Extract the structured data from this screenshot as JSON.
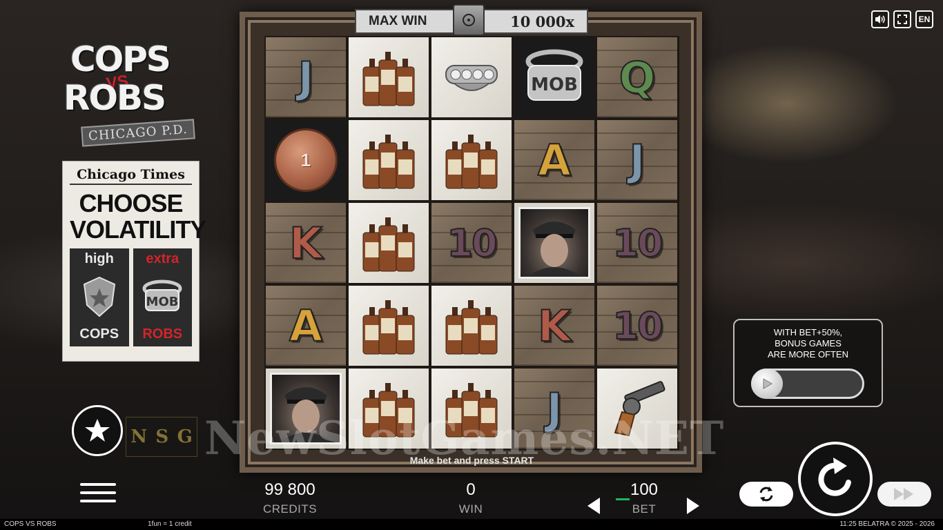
{
  "system": {
    "lang": "EN"
  },
  "logo": {
    "line1": "COPS",
    "vs": "VS",
    "line2": "ROBS",
    "sub": "CHICAGO P.D."
  },
  "volatility": {
    "paper_title": "Chicago Times",
    "headline_1": "CHOOSE",
    "headline_2": "VOLATILITY",
    "options": [
      {
        "top": "high",
        "bottom": "COPS",
        "icon": "police-badge-icon"
      },
      {
        "top": "extra",
        "bottom": "ROBS",
        "icon": "mob-ring-icon"
      }
    ]
  },
  "maxwin": {
    "label": "MAX WIN",
    "value": "10 000x"
  },
  "grid": {
    "rows": [
      [
        "J",
        "whiskey",
        "knuckles",
        "mob-ring",
        "Q"
      ],
      [
        "coin",
        "whiskey",
        "whiskey",
        "A",
        "J"
      ],
      [
        "K",
        "whiskey",
        "10",
        "cop",
        "10"
      ],
      [
        "A",
        "whiskey",
        "whiskey",
        "K",
        "10"
      ],
      [
        "cop",
        "whiskey",
        "whiskey",
        "J",
        "revolver"
      ]
    ],
    "coin_value": "1",
    "bottle_label": "SCOTCH WHISKY"
  },
  "letter_colors": {
    "J": "#7d95ab",
    "Q": "#5e8a50",
    "A": "#d6a23a",
    "K": "#b05a4a",
    "10": "#6a4a5a"
  },
  "make_bet": "Make bet and press START",
  "bonus": {
    "line1": "WITH BET+50%,",
    "line2": "BONUS GAMES",
    "line3": "ARE MORE OFTEN"
  },
  "watermark": "NewSlotGames.NET",
  "provider": {
    "letters": [
      "N",
      "S",
      "G"
    ]
  },
  "stats": {
    "credits_value": "99 800",
    "credits_label": "CREDITS",
    "win_value": "0",
    "win_label": "WIN",
    "bet_value": "100",
    "bet_label": "BET"
  },
  "footer": {
    "title": "COPS VS ROBS",
    "rate": "1fun = 1 credit",
    "right": "11:25  BELATRA © 2025 - 2026"
  }
}
